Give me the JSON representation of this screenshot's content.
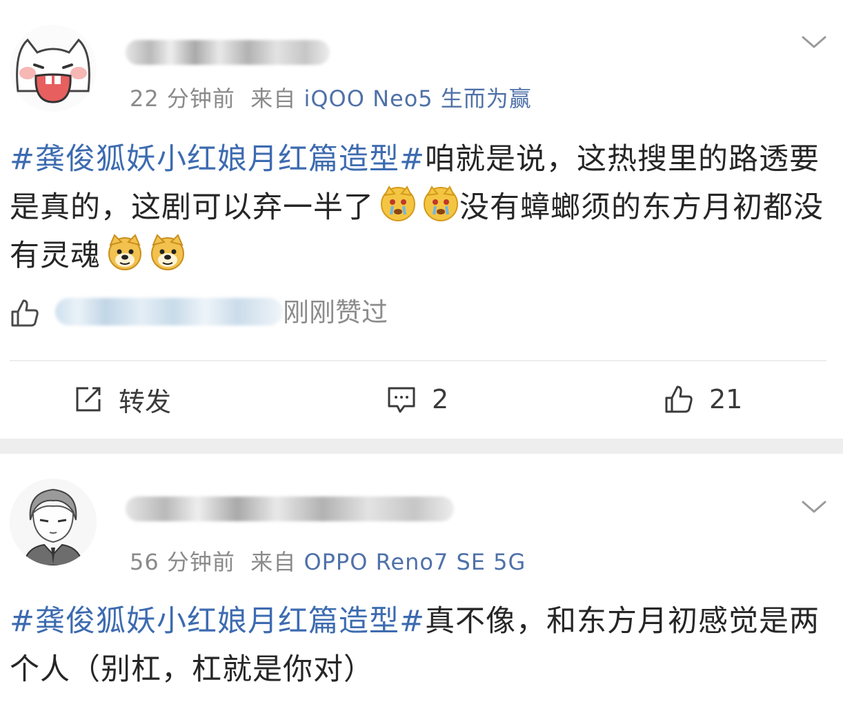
{
  "feed": {
    "posts": [
      {
        "time": "22 分钟前",
        "from_prefix": "来自",
        "source": "iQOO Neo5 生而为赢",
        "hashtag": "#龚俊狐妖小红娘月红篇造型#",
        "text_before_emoji": "咱就是说，这热搜里的路透要是真的，这剧可以弃一半了",
        "text_mid": "没有蟑螂须的东方月初都没有灵魂",
        "emojis_1": [
          "crying-dog-icon",
          "crying-dog-icon"
        ],
        "emojis_2": [
          "doge-icon",
          "doge-icon"
        ],
        "liked_by_suffix": "刚刚赞过",
        "actions": {
          "repost_label": "转发",
          "comment_count": "2",
          "like_count": "21"
        }
      },
      {
        "time": "56 分钟前",
        "from_prefix": "来自",
        "source": "OPPO Reno7 SE 5G",
        "hashtag": "#龚俊狐妖小红娘月红篇造型#",
        "text": "真不像，和东方月初感觉是两个人（别杠，杠就是你对）"
      }
    ]
  },
  "colors": {
    "hashtag": "#3d6bb0",
    "source": "#4f71a8",
    "meta": "#8a8a8a",
    "separator": "#eeeeee"
  }
}
